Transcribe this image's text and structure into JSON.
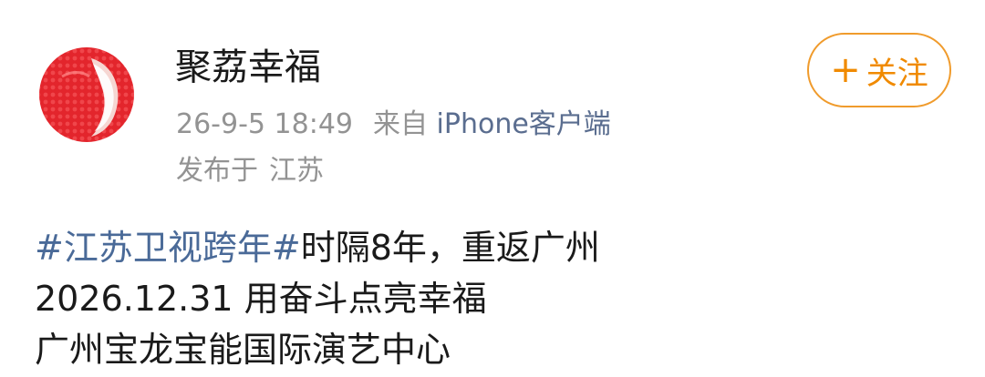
{
  "user": {
    "name": "聚荔幸福",
    "avatar_icon": "lychee-avatar-icon"
  },
  "meta": {
    "time": "26-9-5 18:49",
    "source_label": "来自",
    "source_link": "iPhone客户端",
    "location_label": "发布于",
    "location_value": "江苏"
  },
  "follow_button": {
    "icon": "plus-icon",
    "icon_glyph": "+",
    "label": "关注"
  },
  "post": {
    "hashtag": "#江苏卫视跨年#",
    "line1_text": "时隔8年，重返广州",
    "line2_text": "2026.12.31 用奋斗点亮幸福",
    "line3_text": "广州宝龙宝能国际演艺中心"
  },
  "colors": {
    "accent_orange": "#f09b2c",
    "link_blue": "#4a6a98",
    "meta_gray": "#939393",
    "avatar_red": "#e8282f"
  }
}
